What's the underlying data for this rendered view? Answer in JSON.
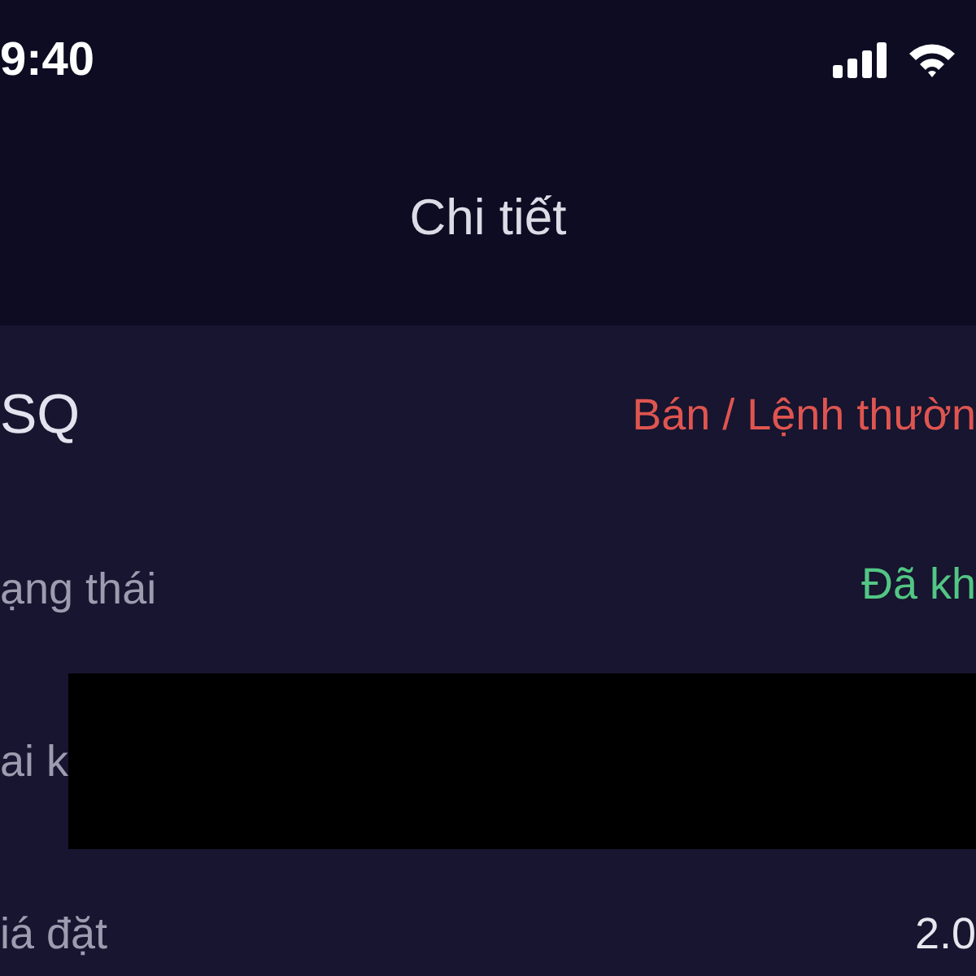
{
  "status_bar": {
    "time": "9:40"
  },
  "nav": {
    "title": "Chi tiết"
  },
  "order": {
    "symbol": "SQ",
    "side": "Bán / Lệnh thườn"
  },
  "rows": [
    {
      "kind": "status",
      "label": "ạng thái",
      "value": "Đã kh"
    },
    {
      "kind": "redacted",
      "label": "ai k"
    },
    {
      "kind": "plain",
      "label": "iá đặt",
      "value": "2.0"
    }
  ]
}
